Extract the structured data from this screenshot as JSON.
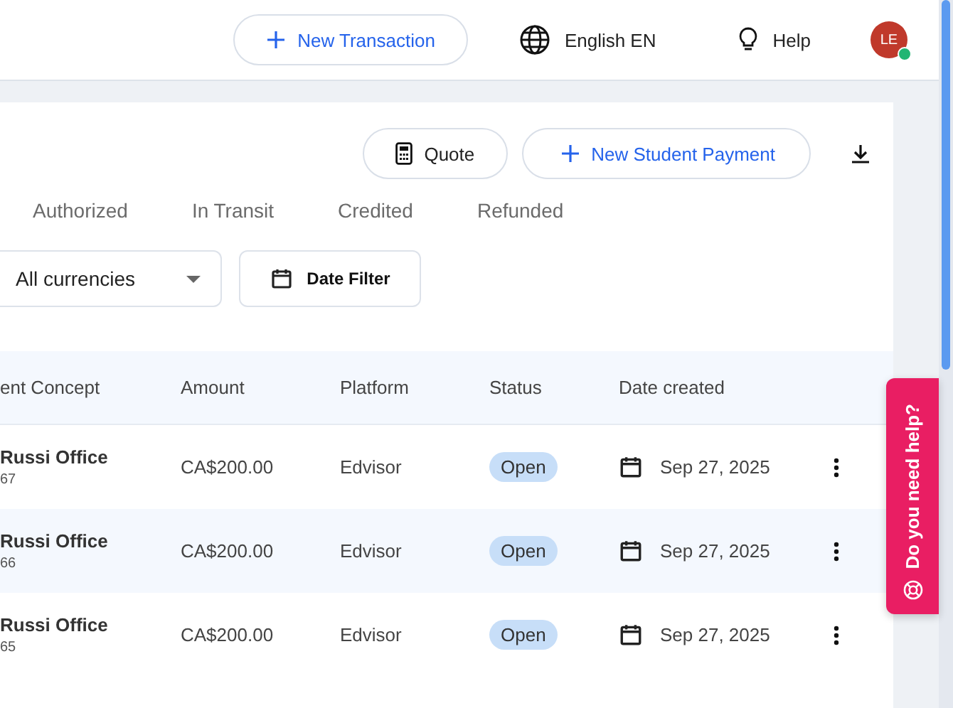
{
  "topbar": {
    "new_transaction": "New Transaction",
    "language": "English EN",
    "help": "Help",
    "avatar": {
      "initials": "LE",
      "online": true
    }
  },
  "actions": {
    "quote": "Quote",
    "new_payment": "New Student Payment"
  },
  "tabs": [
    {
      "label": "Authorized",
      "selected": false
    },
    {
      "label": "In Transit",
      "selected": false
    },
    {
      "label": "Credited",
      "selected": false
    },
    {
      "label": "Refunded",
      "selected": false
    }
  ],
  "filters": {
    "currency": "All currencies",
    "date": "Date Filter"
  },
  "table": {
    "columns": [
      "ent Concept",
      "Amount",
      "Platform",
      "Status",
      "Date created"
    ],
    "rows": [
      {
        "concept": "Russi Office",
        "ref": "67",
        "amount": "CA$200.00",
        "platform": "Edvisor",
        "status": "Open",
        "date": "Sep 27, 2025"
      },
      {
        "concept": "Russi Office",
        "ref": "66",
        "amount": "CA$200.00",
        "platform": "Edvisor",
        "status": "Open",
        "date": "Sep 27, 2025"
      },
      {
        "concept": "Russi Office",
        "ref": "65",
        "amount": "CA$200.00",
        "platform": "Edvisor",
        "status": "Open",
        "date": "Sep 27, 2025"
      }
    ]
  },
  "help_tab": "Do you need help?"
}
